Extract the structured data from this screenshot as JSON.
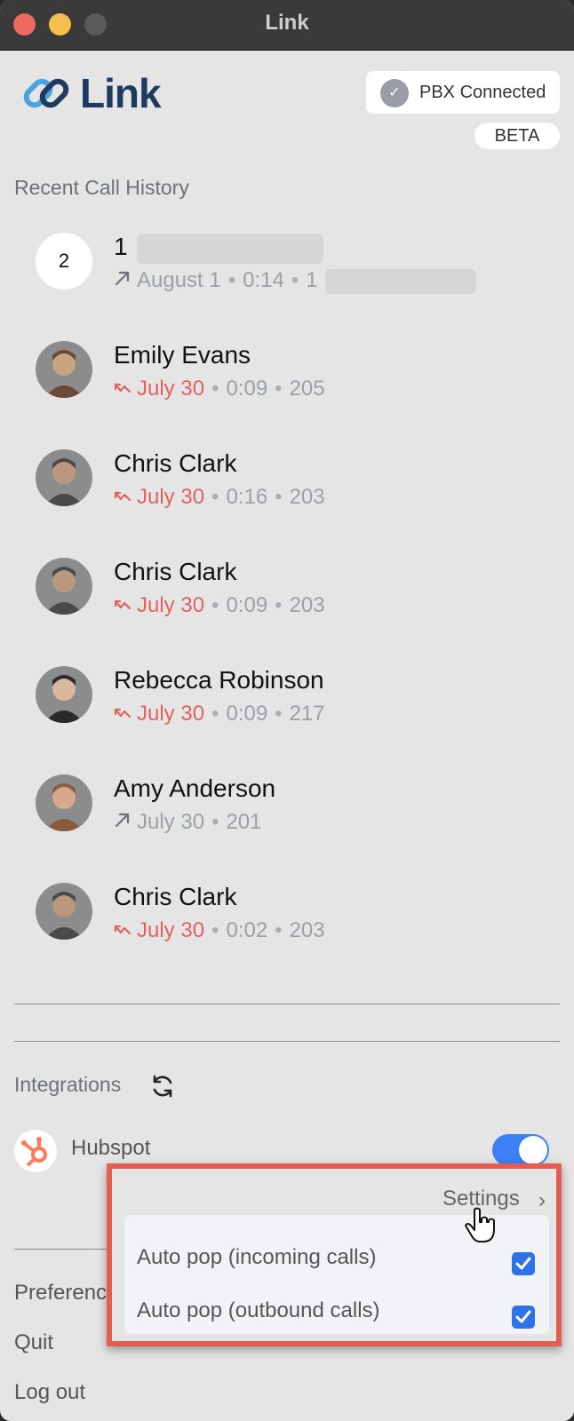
{
  "window": {
    "title": "Link"
  },
  "logo": {
    "text": "Link"
  },
  "status": {
    "pbx": "PBX Connected",
    "beta": "BETA"
  },
  "recent": {
    "title": "Recent Call History",
    "calls": [
      {
        "avatar_text": "2",
        "name": "1",
        "direction": "outgoing",
        "missed": false,
        "date": "August 1",
        "duration": "0:14",
        "ext": "1"
      },
      {
        "name": "Emily Evans",
        "direction": "missed",
        "missed": true,
        "date": "July 30",
        "duration": "0:09",
        "ext": "205"
      },
      {
        "name": "Chris Clark",
        "direction": "missed",
        "missed": true,
        "date": "July 30",
        "duration": "0:16",
        "ext": "203"
      },
      {
        "name": "Chris Clark",
        "direction": "missed",
        "missed": true,
        "date": "July 30",
        "duration": "0:09",
        "ext": "203"
      },
      {
        "name": "Rebecca Robinson",
        "direction": "missed",
        "missed": true,
        "date": "July 30",
        "duration": "0:09",
        "ext": "217"
      },
      {
        "name": "Amy Anderson",
        "direction": "outgoing",
        "missed": false,
        "date": "July 30",
        "duration": "",
        "ext": "201"
      },
      {
        "name": "Chris Clark",
        "direction": "missed",
        "missed": true,
        "date": "July 30",
        "duration": "0:02",
        "ext": "203"
      }
    ]
  },
  "integrations": {
    "title": "Integrations",
    "hubspot": {
      "label": "Hubspot",
      "enabled": true
    },
    "settings_label": "Settings",
    "options": [
      {
        "label": "Auto pop (incoming calls)",
        "checked": true
      },
      {
        "label": "Auto pop (outbound calls)",
        "checked": true
      }
    ]
  },
  "menu": {
    "preferences": "Preferences",
    "quit": "Quit",
    "logout": "Log out"
  },
  "colors": {
    "missed": "#e26262",
    "accent": "#3d7ff5",
    "highlight": "#e35d52",
    "hubspot": "#ff7a59"
  }
}
